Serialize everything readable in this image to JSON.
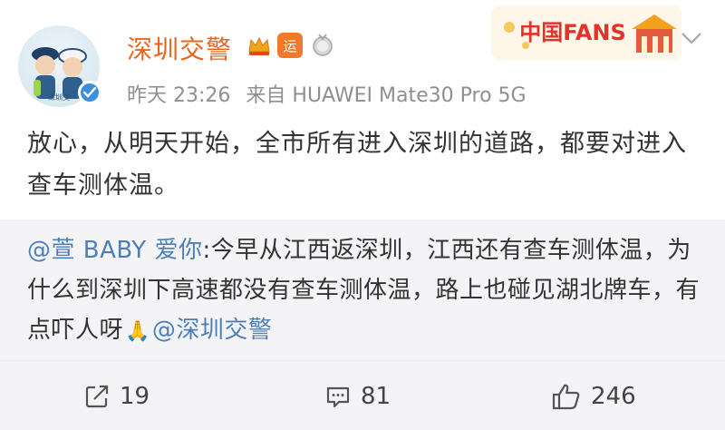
{
  "account": {
    "name": "深圳交警",
    "badge_yun": "运",
    "avatar_caption": "深圳交"
  },
  "meta": {
    "time": "昨天 23:26",
    "source": "来自 HUAWEI Mate30 Pro 5G"
  },
  "promo": {
    "label": "中国FANS"
  },
  "post": {
    "text": "放心，从明天开始，全市所有进入深圳的道路，都要对进入查车测体温。"
  },
  "repost": {
    "author": "@萱 BABY 爱你",
    "text": ":今早从江西返深圳，江西还有查车测体温，为什么到深圳下高速都没有查车测体温，路上也碰见湖北牌车，有点吓人呀",
    "mention": "@深圳交警"
  },
  "actions": {
    "repost_count": "19",
    "comment_count": "81",
    "like_count": "246"
  },
  "colors": {
    "name": "#e8661d",
    "mention": "#4c7fb8",
    "verify": "#3b8fe0",
    "repost_bg": "#f4f4f6",
    "meta": "#8f8f8f"
  },
  "icons": [
    "verified-icon",
    "crown-icon",
    "medal-icon",
    "chevron-down-icon",
    "repost-icon",
    "comment-icon",
    "like-icon",
    "pray-emoji"
  ]
}
